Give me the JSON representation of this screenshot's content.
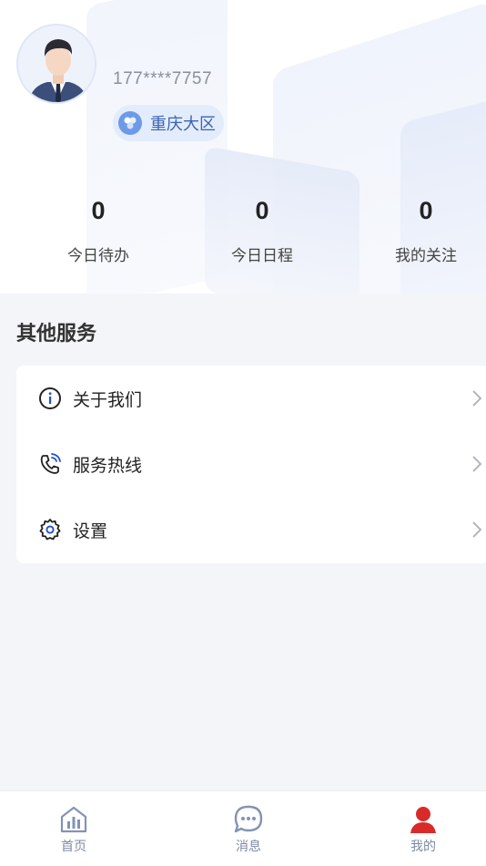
{
  "profile": {
    "phone": "177****7757",
    "region": "重庆大区"
  },
  "stats": [
    {
      "value": "0",
      "label": "今日待办"
    },
    {
      "value": "0",
      "label": "今日日程"
    },
    {
      "value": "0",
      "label": "我的关注"
    }
  ],
  "services": {
    "title": "其他服务",
    "items": [
      {
        "label": "关于我们",
        "icon": "info-icon"
      },
      {
        "label": "服务热线",
        "icon": "phone-icon"
      },
      {
        "label": "设置",
        "icon": "gear-icon"
      }
    ]
  },
  "tabbar": {
    "items": [
      {
        "label": "首页",
        "icon": "home-chart-icon"
      },
      {
        "label": "消息",
        "icon": "chat-bubble-icon"
      },
      {
        "label": "我的",
        "icon": "user-icon",
        "active": true
      }
    ]
  },
  "colors": {
    "accent": "#3a63b5",
    "active_tab_icon": "#d92a2a",
    "inactive_tab_icon": "#8393b3"
  }
}
